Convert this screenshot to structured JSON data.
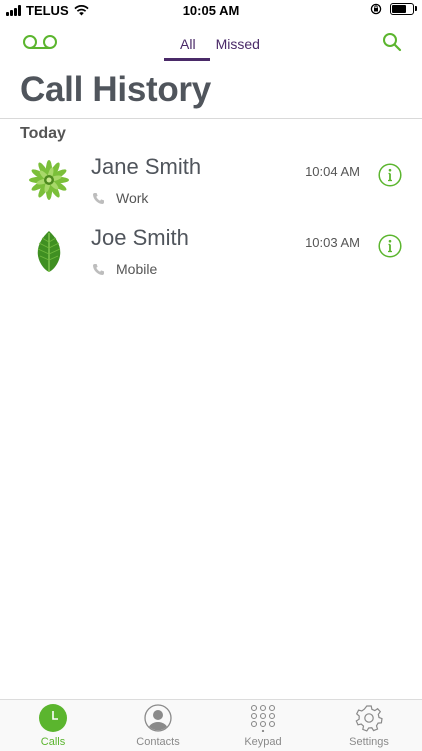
{
  "status_bar": {
    "carrier": "TELUS",
    "time": "10:05 AM",
    "battery_level": 0.7
  },
  "nav": {
    "tabs": [
      {
        "label": "All",
        "active": true
      },
      {
        "label": "Missed",
        "active": false
      }
    ]
  },
  "page_title": "Call History",
  "sections": [
    {
      "header": "Today",
      "calls": [
        {
          "name": "Jane Smith",
          "type": "Work",
          "time": "10:04 AM",
          "avatar": "green-flower"
        },
        {
          "name": "Joe Smith",
          "type": "Mobile",
          "time": "10:03 AM",
          "avatar": "green-leaf"
        }
      ]
    }
  ],
  "tab_bar": {
    "items": [
      {
        "label": "Calls",
        "icon": "clock-icon",
        "active": true
      },
      {
        "label": "Contacts",
        "icon": "person-icon",
        "active": false
      },
      {
        "label": "Keypad",
        "icon": "keypad-icon",
        "active": false
      },
      {
        "label": "Settings",
        "icon": "gear-icon",
        "active": false
      }
    ]
  },
  "colors": {
    "accent_green": "#5bb52e",
    "accent_purple": "#4a2a68",
    "title_gray": "#50555c"
  }
}
